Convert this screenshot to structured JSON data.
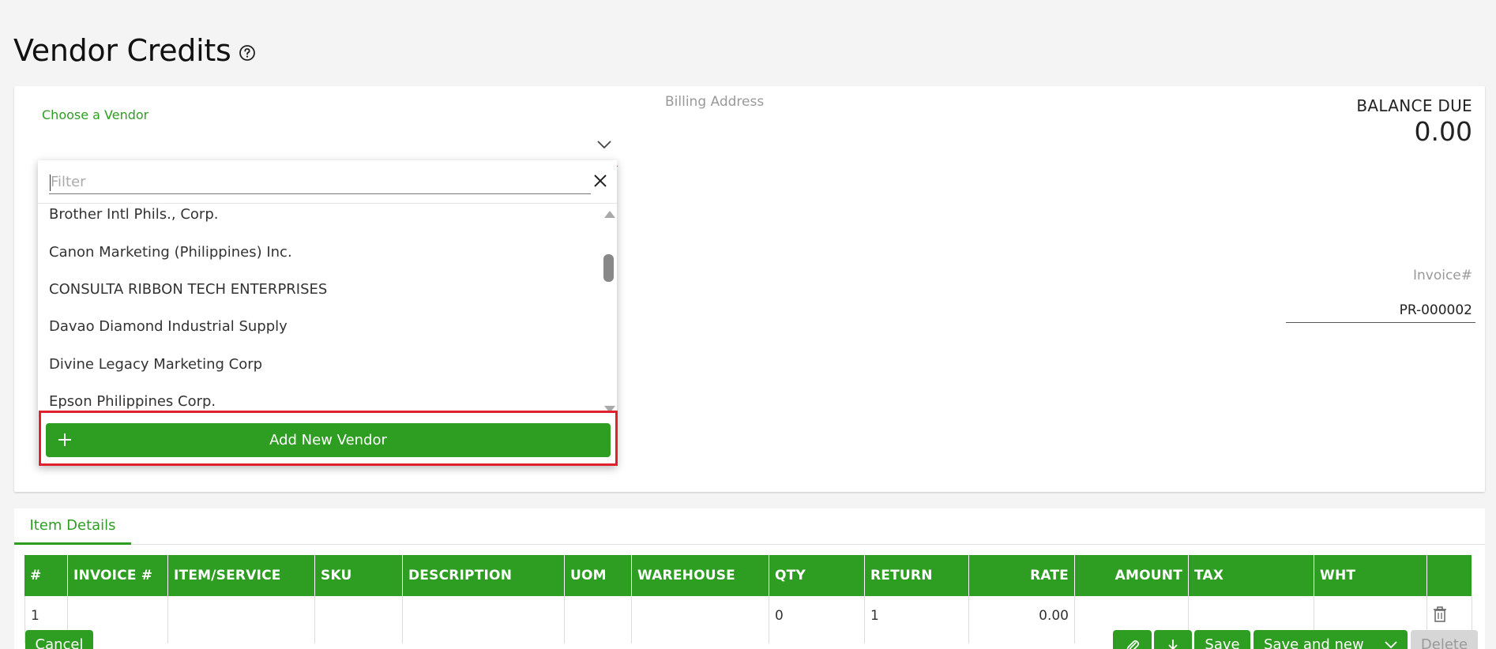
{
  "page": {
    "title": "Vendor Credits"
  },
  "vendor": {
    "label": "Choose a Vendor"
  },
  "billing": {
    "label": "Billing Address"
  },
  "balance": {
    "label": "BALANCE DUE",
    "value": "0.00"
  },
  "invoice": {
    "label": "Invoice#",
    "value": "PR-000002"
  },
  "dropdown": {
    "filter_placeholder": "Filter",
    "items": [
      "Brother Intl Phils., Corp.",
      "Canon Marketing (Philippines) Inc.",
      "CONSULTA RIBBON TECH ENTERPRISES",
      "Davao Diamond Industrial Supply",
      "Divine Legacy Marketing Corp",
      "Epson Philippines Corp."
    ],
    "add_label": "Add New Vendor"
  },
  "tabs": [
    {
      "label": "Item Details",
      "active": true
    }
  ],
  "table": {
    "headers": [
      "#",
      "INVOICE #",
      "ITEM/SERVICE",
      "SKU",
      "DESCRIPTION",
      "UOM",
      "WAREHOUSE",
      "QTY",
      "RETURN",
      "RATE",
      "AMOUNT",
      "TAX",
      "WHT",
      ""
    ],
    "rows": [
      [
        "1",
        "",
        "",
        "",
        "",
        "",
        "",
        "0",
        "1",
        "0.00",
        "",
        "",
        "",
        ""
      ]
    ]
  },
  "footer": {
    "cancel": "Cancel",
    "save": "Save",
    "save_and_new": "Save and new",
    "delete": "Delete"
  },
  "colors": {
    "accent": "#2e9e22",
    "highlight": "#e0202a"
  }
}
